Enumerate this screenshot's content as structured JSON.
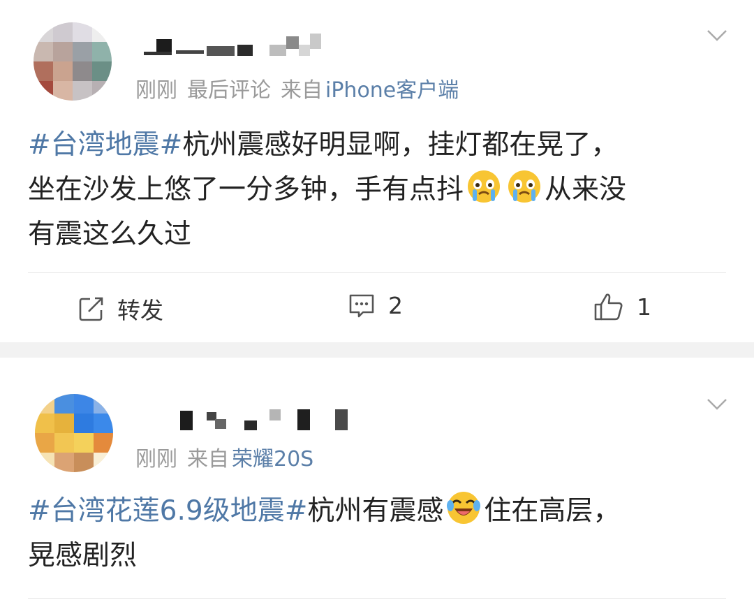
{
  "posts": [
    {
      "meta": {
        "time": "刚刚",
        "tag": "最后评论",
        "source_prefix": "来自",
        "source": "iPhone客户端"
      },
      "text": {
        "hashtag": "#台湾地震#",
        "line1": "杭州震感好明显啊，挂灯都在晃了，",
        "line2a": "坐在沙发上悠了一分多钟，手有点抖",
        "line2b": "从来没",
        "line3": "有震这么久过"
      },
      "emojis": [
        "crying-face-emoji",
        "crying-face-emoji"
      ],
      "actions": {
        "repost_label": "转发",
        "comment_count": "2",
        "like_count": "1"
      }
    },
    {
      "meta": {
        "time": "刚刚",
        "source_prefix": "来自",
        "source": "荣耀20S"
      },
      "text": {
        "hashtag": "#台湾花莲6.9级地震#",
        "line1": "杭州有震感",
        "line1b": "住在高层，",
        "line2": "晃感剧烈"
      },
      "emojis": [
        "laughing-tears-emoji"
      ]
    }
  ],
  "colors": {
    "link": "#4f78a6",
    "meta": "#9a9a9a",
    "text": "#222222",
    "separator": "#f2f2f2"
  }
}
